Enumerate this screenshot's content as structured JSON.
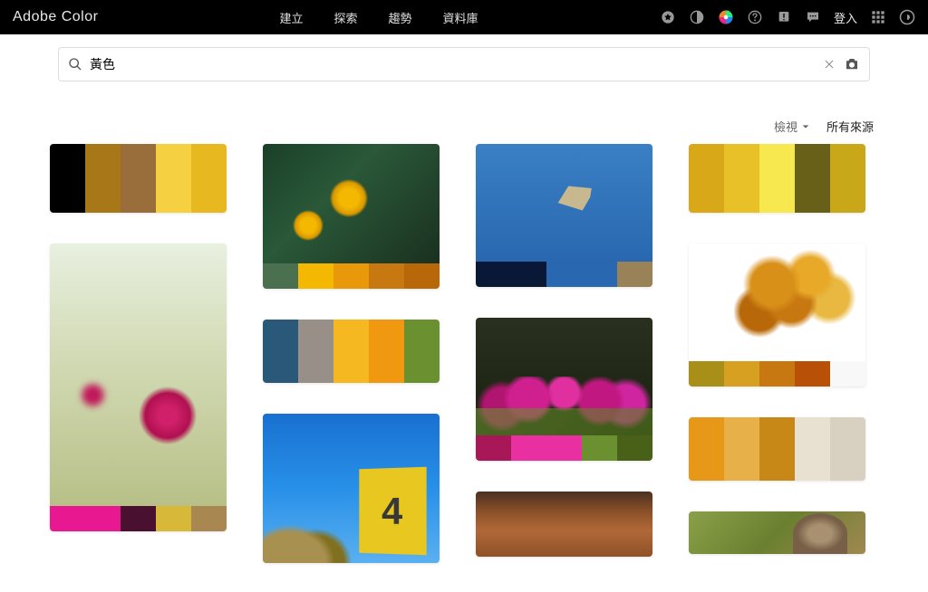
{
  "header": {
    "brand": "Adobe Color",
    "nav": [
      "建立",
      "探索",
      "趨勢",
      "資料庫"
    ],
    "login": "登入"
  },
  "search": {
    "value": "黃色",
    "placeholder": ""
  },
  "controls": {
    "view": "檢視",
    "source": "所有來源"
  },
  "cards": {
    "c1": {
      "type": "palette",
      "colors": [
        "#000000",
        "#a87818",
        "#9a6e3a",
        "#f5d040",
        "#e8b820"
      ]
    },
    "c2": {
      "type": "image-palette",
      "img": "cosmos",
      "colors": [
        "#e81890",
        "#e81890",
        "#4a1030",
        "#d8b838",
        "#a88850"
      ]
    },
    "c3": {
      "type": "image-palette",
      "img": "flowers",
      "colors": [
        "#4a7050",
        "#f5b800",
        "#e89808",
        "#c87810",
        "#b86808"
      ]
    },
    "c4": {
      "type": "palette",
      "colors": [
        "#2a5878",
        "#989088",
        "#f5b820",
        "#f09810",
        "#6a9030"
      ]
    },
    "c5": {
      "type": "image",
      "img": "sign"
    },
    "c6": {
      "type": "image-palette",
      "img": "bird",
      "colors": [
        "#0a1838",
        "#0a1838",
        "#2968b0",
        "#2968b0",
        "#9a8258"
      ]
    },
    "c7": {
      "type": "image-palette",
      "img": "tulips",
      "colors": [
        "#a81858",
        "#e830a0",
        "#e830a0",
        "#6a9030",
        "#486018"
      ]
    },
    "c8": {
      "type": "image",
      "img": "sky"
    },
    "c9": {
      "type": "palette",
      "colors": [
        "#d8a818",
        "#e8c028",
        "#f8e850",
        "#686018",
        "#c8a818"
      ]
    },
    "c10": {
      "type": "image-palette",
      "img": "leaves",
      "colors": [
        "#a89018",
        "#d8a020",
        "#c87810",
        "#b85008",
        "#f8f8f8"
      ]
    },
    "c11": {
      "type": "palette",
      "colors": [
        "#e89818",
        "#e8b048",
        "#c88818",
        "#e8e0d0",
        "#d8d0c0"
      ]
    },
    "c12": {
      "type": "image",
      "img": "cat"
    }
  }
}
